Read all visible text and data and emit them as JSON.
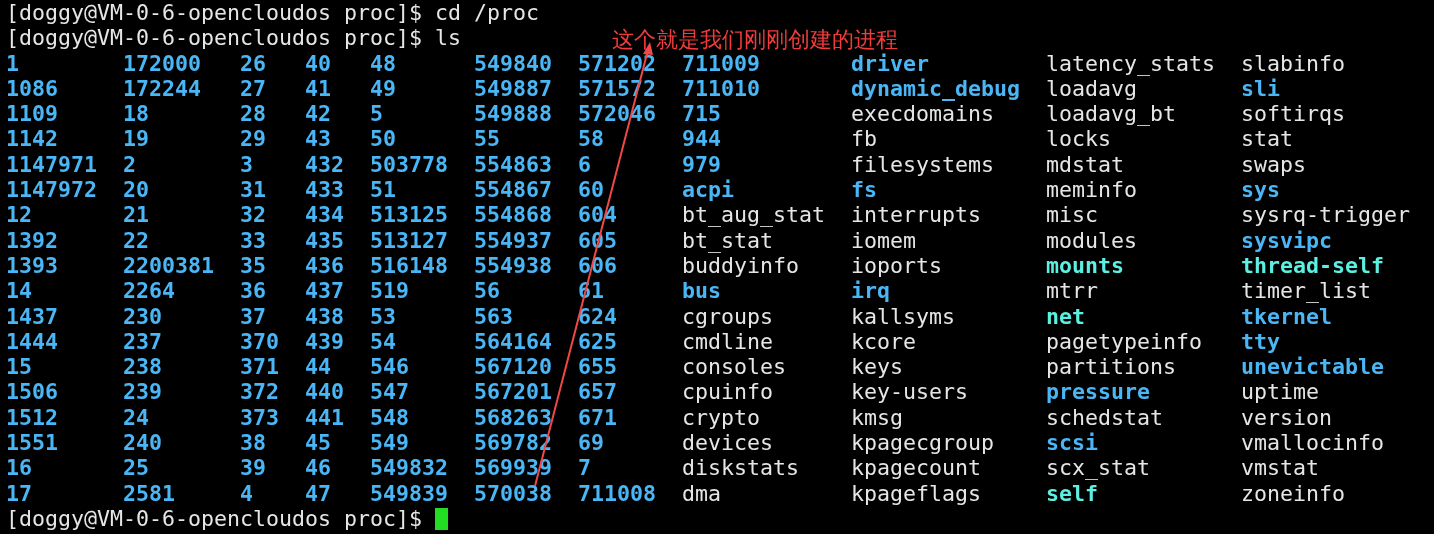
{
  "terminal": {
    "lines": [
      {
        "text": "[doggy@VM-0-6-opencloudos proc]$ cd /proc"
      },
      {
        "text": "[doggy@VM-0-6-opencloudos proc]$ ls"
      }
    ],
    "listing": {
      "columns": [
        [
          {
            "name": "1",
            "kind": "dir"
          },
          {
            "name": "1086",
            "kind": "dir"
          },
          {
            "name": "1109",
            "kind": "dir"
          },
          {
            "name": "1142",
            "kind": "dir"
          },
          {
            "name": "1147971",
            "kind": "dir"
          },
          {
            "name": "1147972",
            "kind": "dir"
          },
          {
            "name": "12",
            "kind": "dir"
          },
          {
            "name": "1392",
            "kind": "dir"
          },
          {
            "name": "1393",
            "kind": "dir"
          },
          {
            "name": "14",
            "kind": "dir"
          },
          {
            "name": "1437",
            "kind": "dir"
          },
          {
            "name": "1444",
            "kind": "dir"
          },
          {
            "name": "15",
            "kind": "dir"
          },
          {
            "name": "1506",
            "kind": "dir"
          },
          {
            "name": "1512",
            "kind": "dir"
          },
          {
            "name": "1551",
            "kind": "dir"
          },
          {
            "name": "16",
            "kind": "dir"
          },
          {
            "name": "17",
            "kind": "dir"
          }
        ],
        [
          {
            "name": "172000",
            "kind": "dir"
          },
          {
            "name": "172244",
            "kind": "dir"
          },
          {
            "name": "18",
            "kind": "dir"
          },
          {
            "name": "19",
            "kind": "dir"
          },
          {
            "name": "2",
            "kind": "dir"
          },
          {
            "name": "20",
            "kind": "dir"
          },
          {
            "name": "21",
            "kind": "dir"
          },
          {
            "name": "22",
            "kind": "dir"
          },
          {
            "name": "2200381",
            "kind": "dir"
          },
          {
            "name": "2264",
            "kind": "dir"
          },
          {
            "name": "230",
            "kind": "dir"
          },
          {
            "name": "237",
            "kind": "dir"
          },
          {
            "name": "238",
            "kind": "dir"
          },
          {
            "name": "239",
            "kind": "dir"
          },
          {
            "name": "24",
            "kind": "dir"
          },
          {
            "name": "240",
            "kind": "dir"
          },
          {
            "name": "25",
            "kind": "dir"
          },
          {
            "name": "2581",
            "kind": "dir"
          }
        ],
        [
          {
            "name": "26",
            "kind": "dir"
          },
          {
            "name": "27",
            "kind": "dir"
          },
          {
            "name": "28",
            "kind": "dir"
          },
          {
            "name": "29",
            "kind": "dir"
          },
          {
            "name": "3",
            "kind": "dir"
          },
          {
            "name": "31",
            "kind": "dir"
          },
          {
            "name": "32",
            "kind": "dir"
          },
          {
            "name": "33",
            "kind": "dir"
          },
          {
            "name": "35",
            "kind": "dir"
          },
          {
            "name": "36",
            "kind": "dir"
          },
          {
            "name": "37",
            "kind": "dir"
          },
          {
            "name": "370",
            "kind": "dir"
          },
          {
            "name": "371",
            "kind": "dir"
          },
          {
            "name": "372",
            "kind": "dir"
          },
          {
            "name": "373",
            "kind": "dir"
          },
          {
            "name": "38",
            "kind": "dir"
          },
          {
            "name": "39",
            "kind": "dir"
          },
          {
            "name": "4",
            "kind": "dir"
          }
        ],
        [
          {
            "name": "40",
            "kind": "dir"
          },
          {
            "name": "41",
            "kind": "dir"
          },
          {
            "name": "42",
            "kind": "dir"
          },
          {
            "name": "43",
            "kind": "dir"
          },
          {
            "name": "432",
            "kind": "dir"
          },
          {
            "name": "433",
            "kind": "dir"
          },
          {
            "name": "434",
            "kind": "dir"
          },
          {
            "name": "435",
            "kind": "dir"
          },
          {
            "name": "436",
            "kind": "dir"
          },
          {
            "name": "437",
            "kind": "dir"
          },
          {
            "name": "438",
            "kind": "dir"
          },
          {
            "name": "439",
            "kind": "dir"
          },
          {
            "name": "44",
            "kind": "dir"
          },
          {
            "name": "440",
            "kind": "dir"
          },
          {
            "name": "441",
            "kind": "dir"
          },
          {
            "name": "45",
            "kind": "dir"
          },
          {
            "name": "46",
            "kind": "dir"
          },
          {
            "name": "47",
            "kind": "dir"
          }
        ],
        [
          {
            "name": "48",
            "kind": "dir"
          },
          {
            "name": "49",
            "kind": "dir"
          },
          {
            "name": "5",
            "kind": "dir"
          },
          {
            "name": "50",
            "kind": "dir"
          },
          {
            "name": "503778",
            "kind": "dir"
          },
          {
            "name": "51",
            "kind": "dir"
          },
          {
            "name": "513125",
            "kind": "dir"
          },
          {
            "name": "513127",
            "kind": "dir"
          },
          {
            "name": "516148",
            "kind": "dir"
          },
          {
            "name": "519",
            "kind": "dir"
          },
          {
            "name": "53",
            "kind": "dir"
          },
          {
            "name": "54",
            "kind": "dir"
          },
          {
            "name": "546",
            "kind": "dir"
          },
          {
            "name": "547",
            "kind": "dir"
          },
          {
            "name": "548",
            "kind": "dir"
          },
          {
            "name": "549",
            "kind": "dir"
          },
          {
            "name": "549832",
            "kind": "dir"
          },
          {
            "name": "549839",
            "kind": "dir"
          }
        ],
        [
          {
            "name": "549840",
            "kind": "dir"
          },
          {
            "name": "549887",
            "kind": "dir"
          },
          {
            "name": "549888",
            "kind": "dir"
          },
          {
            "name": "55",
            "kind": "dir"
          },
          {
            "name": "554863",
            "kind": "dir"
          },
          {
            "name": "554867",
            "kind": "dir"
          },
          {
            "name": "554868",
            "kind": "dir"
          },
          {
            "name": "554937",
            "kind": "dir"
          },
          {
            "name": "554938",
            "kind": "dir"
          },
          {
            "name": "56",
            "kind": "dir"
          },
          {
            "name": "563",
            "kind": "dir"
          },
          {
            "name": "564164",
            "kind": "dir"
          },
          {
            "name": "567120",
            "kind": "dir"
          },
          {
            "name": "567201",
            "kind": "dir"
          },
          {
            "name": "568263",
            "kind": "dir"
          },
          {
            "name": "569782",
            "kind": "dir"
          },
          {
            "name": "569939",
            "kind": "dir"
          },
          {
            "name": "570038",
            "kind": "dir"
          }
        ],
        [
          {
            "name": "571202",
            "kind": "dir"
          },
          {
            "name": "571572",
            "kind": "dir"
          },
          {
            "name": "572046",
            "kind": "dir"
          },
          {
            "name": "58",
            "kind": "dir"
          },
          {
            "name": "6",
            "kind": "dir"
          },
          {
            "name": "60",
            "kind": "dir"
          },
          {
            "name": "604",
            "kind": "dir"
          },
          {
            "name": "605",
            "kind": "dir"
          },
          {
            "name": "606",
            "kind": "dir"
          },
          {
            "name": "61",
            "kind": "dir"
          },
          {
            "name": "624",
            "kind": "dir"
          },
          {
            "name": "625",
            "kind": "dir"
          },
          {
            "name": "655",
            "kind": "dir"
          },
          {
            "name": "657",
            "kind": "dir"
          },
          {
            "name": "671",
            "kind": "dir"
          },
          {
            "name": "69",
            "kind": "dir"
          },
          {
            "name": "7",
            "kind": "dir"
          },
          {
            "name": "711008",
            "kind": "dir"
          }
        ],
        [
          {
            "name": "711009",
            "kind": "dir"
          },
          {
            "name": "711010",
            "kind": "dir"
          },
          {
            "name": "715",
            "kind": "dir"
          },
          {
            "name": "944",
            "kind": "dir"
          },
          {
            "name": "979",
            "kind": "dir"
          },
          {
            "name": "acpi",
            "kind": "dir"
          },
          {
            "name": "bt_aug_stat",
            "kind": "file"
          },
          {
            "name": "bt_stat",
            "kind": "file"
          },
          {
            "name": "buddyinfo",
            "kind": "file"
          },
          {
            "name": "bus",
            "kind": "dir"
          },
          {
            "name": "cgroups",
            "kind": "file"
          },
          {
            "name": "cmdline",
            "kind": "file"
          },
          {
            "name": "consoles",
            "kind": "file"
          },
          {
            "name": "cpuinfo",
            "kind": "file"
          },
          {
            "name": "crypto",
            "kind": "file"
          },
          {
            "name": "devices",
            "kind": "file"
          },
          {
            "name": "diskstats",
            "kind": "file"
          },
          {
            "name": "dma",
            "kind": "file"
          }
        ],
        [
          {
            "name": "driver",
            "kind": "dir"
          },
          {
            "name": "dynamic_debug",
            "kind": "dir"
          },
          {
            "name": "execdomains",
            "kind": "file"
          },
          {
            "name": "fb",
            "kind": "file"
          },
          {
            "name": "filesystems",
            "kind": "file"
          },
          {
            "name": "fs",
            "kind": "dir"
          },
          {
            "name": "interrupts",
            "kind": "file"
          },
          {
            "name": "iomem",
            "kind": "file"
          },
          {
            "name": "ioports",
            "kind": "file"
          },
          {
            "name": "irq",
            "kind": "dir"
          },
          {
            "name": "kallsyms",
            "kind": "file"
          },
          {
            "name": "kcore",
            "kind": "file"
          },
          {
            "name": "keys",
            "kind": "file"
          },
          {
            "name": "key-users",
            "kind": "file"
          },
          {
            "name": "kmsg",
            "kind": "file"
          },
          {
            "name": "kpagecgroup",
            "kind": "file"
          },
          {
            "name": "kpagecount",
            "kind": "file"
          },
          {
            "name": "kpageflags",
            "kind": "file"
          }
        ],
        [
          {
            "name": "latency_stats",
            "kind": "file"
          },
          {
            "name": "loadavg",
            "kind": "file"
          },
          {
            "name": "loadavg_bt",
            "kind": "file"
          },
          {
            "name": "locks",
            "kind": "file"
          },
          {
            "name": "mdstat",
            "kind": "file"
          },
          {
            "name": "meminfo",
            "kind": "file"
          },
          {
            "name": "misc",
            "kind": "file"
          },
          {
            "name": "modules",
            "kind": "file"
          },
          {
            "name": "mounts",
            "kind": "link"
          },
          {
            "name": "mtrr",
            "kind": "file"
          },
          {
            "name": "net",
            "kind": "link"
          },
          {
            "name": "pagetypeinfo",
            "kind": "file"
          },
          {
            "name": "partitions",
            "kind": "file"
          },
          {
            "name": "pressure",
            "kind": "dir"
          },
          {
            "name": "schedstat",
            "kind": "file"
          },
          {
            "name": "scsi",
            "kind": "dir"
          },
          {
            "name": "scx_stat",
            "kind": "file"
          },
          {
            "name": "self",
            "kind": "link"
          }
        ],
        [
          {
            "name": "slabinfo",
            "kind": "file"
          },
          {
            "name": "sli",
            "kind": "dir"
          },
          {
            "name": "softirqs",
            "kind": "file"
          },
          {
            "name": "stat",
            "kind": "file"
          },
          {
            "name": "swaps",
            "kind": "file"
          },
          {
            "name": "sys",
            "kind": "dir"
          },
          {
            "name": "sysrq-trigger",
            "kind": "file"
          },
          {
            "name": "sysvipc",
            "kind": "dir"
          },
          {
            "name": "thread-self",
            "kind": "link"
          },
          {
            "name": "timer_list",
            "kind": "file"
          },
          {
            "name": "tkernel",
            "kind": "dir"
          },
          {
            "name": "tty",
            "kind": "dir"
          },
          {
            "name": "unevictable",
            "kind": "dir"
          },
          {
            "name": "uptime",
            "kind": "file"
          },
          {
            "name": "version",
            "kind": "file"
          },
          {
            "name": "vmallocinfo",
            "kind": "file"
          },
          {
            "name": "vmstat",
            "kind": "file"
          },
          {
            "name": "zoneinfo",
            "kind": "file"
          }
        ]
      ]
    },
    "last_line": {
      "text": "[doggy@VM-0-6-opencloudos proc]$",
      "cursor": true
    }
  },
  "annotation": {
    "text": "这个就是我们刚刚创建的进程"
  }
}
